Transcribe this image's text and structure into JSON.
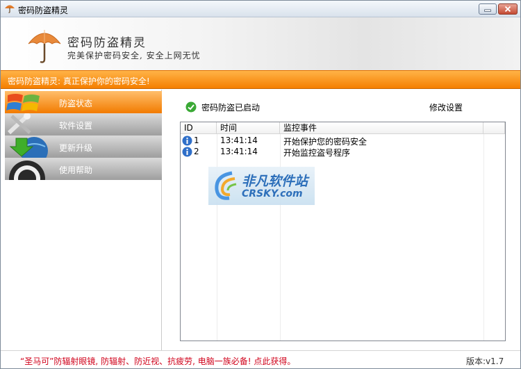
{
  "window": {
    "title": "密码防盗精灵"
  },
  "header": {
    "brand": "密码防盗精灵",
    "slogan": "完美保护密码安全, 安全上网无忧"
  },
  "banner": {
    "text": "密码防盗精灵: 真正保护你的密码安全!"
  },
  "sidebar": {
    "items": [
      {
        "label": "防盗状态",
        "icon": "windows-logo-icon",
        "active": true
      },
      {
        "label": "软件设置",
        "icon": "tools-icon",
        "active": false
      },
      {
        "label": "更新升级",
        "icon": "download-globe-icon",
        "active": false
      },
      {
        "label": "使用帮助",
        "icon": "target-icon",
        "active": false
      }
    ]
  },
  "main": {
    "status_text": "密码防盗已启动",
    "settings_link": "修改设置",
    "columns": [
      "ID",
      "时间",
      "监控事件",
      ""
    ],
    "rows": [
      {
        "id": "1",
        "time": "13:41:14",
        "event": "开始保护您的密码安全"
      },
      {
        "id": "2",
        "time": "13:41:14",
        "event": "开始监控盗号程序"
      }
    ]
  },
  "watermark": {
    "title": "非凡软件站",
    "subtitle": "CRSKY.com"
  },
  "footer": {
    "promo": "“圣马可”防辐射眼镜, 防辐射、防近视、抗疲劳, 电脑一族必备! 点此获得。",
    "version": "版本:v1.7"
  },
  "colors": {
    "accent": "#f57f00",
    "promo": "#d0021b",
    "link": "#1c63b5"
  }
}
